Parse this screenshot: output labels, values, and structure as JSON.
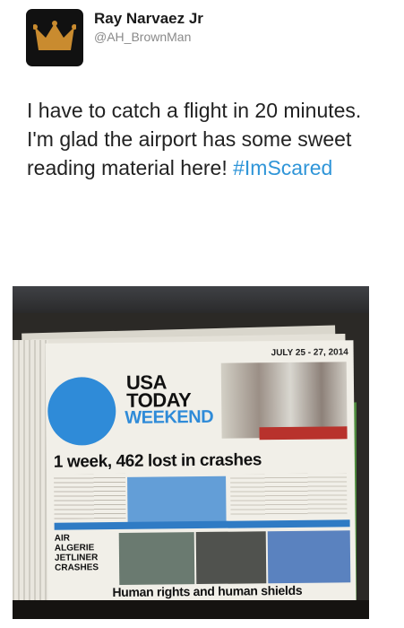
{
  "tweet": {
    "display_name": "Ray Narvaez Jr",
    "handle": "@AH_BrownMan",
    "text": "I have to catch a flight in 20 minutes. I'm glad the airport has some sweet reading material here!",
    "hashtag": "#ImScared",
    "avatar_icon": "crown-icon",
    "colors": {
      "hashtag": "#2f95d8",
      "avatar_bg": "#111111",
      "crown": "#c98b2f"
    }
  },
  "photo": {
    "newspaper": {
      "date": "JULY 25 - 27, 2014",
      "logo": [
        "USA",
        "TODAY",
        "WEEKEND"
      ],
      "headline": "1 week, 462 lost in crashes",
      "sidebar_story": "AIR ALGERIE JETLINER CRASHES",
      "bottom_headline": "Human rights and human shields"
    }
  }
}
